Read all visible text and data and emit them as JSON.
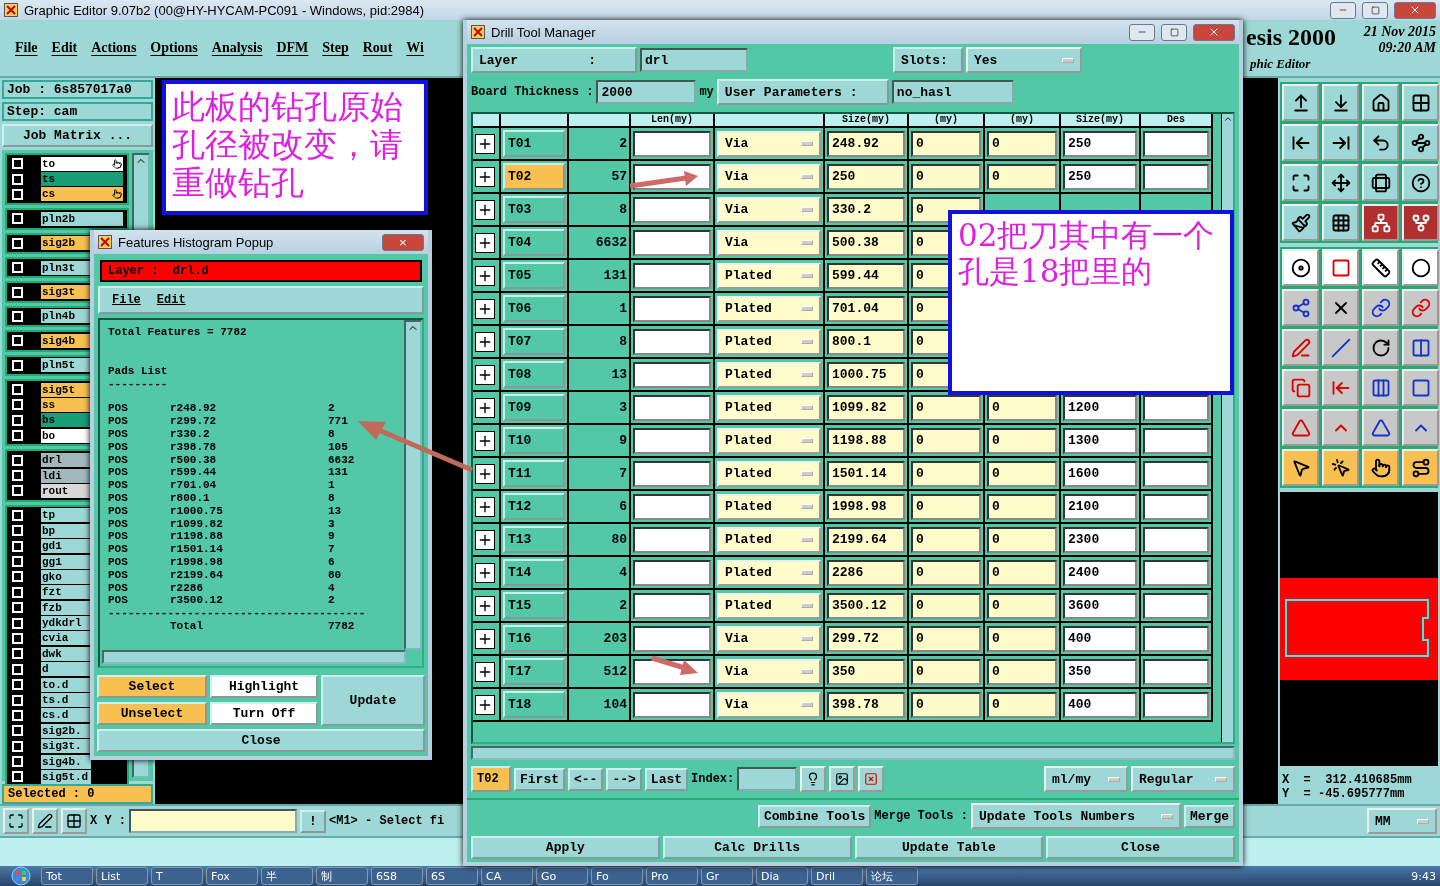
{
  "app": {
    "title": "Graphic Editor 9.07b2 (00@HY-HYCAM-PC091 - Windows, pid:2984)",
    "menu": [
      "File",
      "Edit",
      "Actions",
      "Options",
      "Analysis",
      "DFM",
      "Step",
      "Rout",
      "Wi"
    ],
    "logo_title": "esis 2000",
    "logo_subtitle": "phic Editor",
    "date": "21 Nov 2015",
    "time": "09:20 AM"
  },
  "left_panel": {
    "job": "Job : 6s857017a0",
    "step": "Step: cam",
    "job_matrix": "Job Matrix ...",
    "selected": "Selected : 0",
    "layer_groups": [
      [
        {
          "name": "to",
          "color": "#ffffff",
          "pointer": true,
          "checked": false
        },
        {
          "name": "ts",
          "color": "#1a9e78",
          "pointer": false,
          "checked": false
        },
        {
          "name": "cs",
          "color": "#f8c050",
          "pointer": true,
          "checked": false
        }
      ],
      [
        {
          "name": "pln2b",
          "color": "#9ed8d6",
          "pointer": false,
          "checked": false
        }
      ],
      [
        {
          "name": "sig2b",
          "color": "#f8c050",
          "pointer": false,
          "checked": false
        }
      ],
      [
        {
          "name": "pln3t",
          "color": "#9ed8d6",
          "pointer": false,
          "checked": false
        }
      ],
      [
        {
          "name": "sig3t",
          "color": "#f8c050",
          "pointer": false,
          "checked": false
        }
      ],
      [
        {
          "name": "pln4b",
          "color": "#9ed8d6",
          "pointer": false,
          "checked": false
        }
      ],
      [
        {
          "name": "sig4b",
          "color": "#f8c050",
          "pointer": false,
          "checked": false
        }
      ],
      [
        {
          "name": "pln5t",
          "color": "#9ed8d6",
          "pointer": false,
          "checked": false
        }
      ],
      [
        {
          "name": "sig5t",
          "color": "#f8c050",
          "pointer": false,
          "checked": false
        },
        {
          "name": "ss",
          "color": "#f8c050",
          "pointer": false,
          "checked": false
        },
        {
          "name": "bs",
          "color": "#1a9e78",
          "pointer": false,
          "checked": false
        },
        {
          "name": "bo",
          "color": "#ffffff",
          "pointer": false,
          "checked": false
        }
      ],
      [
        {
          "name": "drl",
          "color": "#a3b8bc",
          "pointer": false,
          "checked": false
        },
        {
          "name": "ldi",
          "color": "#a3b8bc",
          "pointer": false,
          "checked": false
        },
        {
          "name": "rout",
          "color": "#d8d8d8",
          "pointer": false,
          "checked": false
        }
      ],
      [
        {
          "name": "tp",
          "color": "#9ed8d6",
          "pointer": false,
          "checked": false
        },
        {
          "name": "bp",
          "color": "#9ed8d6",
          "pointer": false,
          "checked": false
        },
        {
          "name": "gd1",
          "color": "#9ed8d6",
          "pointer": false,
          "checked": false
        },
        {
          "name": "gg1",
          "color": "#9ed8d6",
          "pointer": false,
          "checked": false
        },
        {
          "name": "gko",
          "color": "#9ed8d6",
          "pointer": false,
          "checked": false
        },
        {
          "name": "fzt",
          "color": "#9ed8d6",
          "pointer": false,
          "checked": false
        },
        {
          "name": "fzb",
          "color": "#9ed8d6",
          "pointer": false,
          "checked": false
        },
        {
          "name": "ydkdrl",
          "color": "#9ed8d6",
          "pointer": false,
          "checked": false
        },
        {
          "name": "cvia",
          "color": "#9ed8d6",
          "pointer": false,
          "checked": false
        },
        {
          "name": "dwk",
          "color": "#9ed8d6",
          "pointer": false,
          "checked": false
        },
        {
          "name": "d",
          "color": "#9ed8d6",
          "pointer": false,
          "checked": false
        },
        {
          "name": "to.d",
          "color": "#9ed8d6",
          "pointer": false,
          "checked": false
        },
        {
          "name": "ts.d",
          "color": "#9ed8d6",
          "pointer": false,
          "checked": false
        },
        {
          "name": "cs.d",
          "color": "#9ed8d6",
          "pointer": false,
          "checked": false
        },
        {
          "name": "sig2b.",
          "color": "#9ed8d6",
          "pointer": false,
          "checked": false
        },
        {
          "name": "sig3t.",
          "color": "#9ed8d6",
          "pointer": false,
          "checked": false
        },
        {
          "name": "sig4b.",
          "color": "#9ed8d6",
          "pointer": false,
          "checked": false
        },
        {
          "name": "sig5t.d",
          "color": "#9ed8d6",
          "pointer": false,
          "checked": false
        }
      ]
    ]
  },
  "annotations": [
    {
      "text": "此板的钻孔原始孔径被改变，请重做钻孔"
    },
    {
      "text": "02把刀其中有一个孔是18把里的"
    }
  ],
  "histogram": {
    "title": "Features Histogram Popup",
    "close": "×",
    "layer": "Layer :  drl.d",
    "menu": [
      "File",
      "Edit"
    ],
    "total_features": "Total Features = 7782",
    "pads_title": "Pads List",
    "pads_rule": "---------",
    "pads": [
      {
        "type": "POS",
        "symbol": "r248.92",
        "count": "2"
      },
      {
        "type": "POS",
        "symbol": "r299.72",
        "count": "771"
      },
      {
        "type": "POS",
        "symbol": "r330.2",
        "count": "8"
      },
      {
        "type": "POS",
        "symbol": "r398.78",
        "count": "105"
      },
      {
        "type": "POS",
        "symbol": "r500.38",
        "count": "6632"
      },
      {
        "type": "POS",
        "symbol": "r599.44",
        "count": "131"
      },
      {
        "type": "POS",
        "symbol": "r701.04",
        "count": "1"
      },
      {
        "type": "POS",
        "symbol": "r800.1",
        "count": "8"
      },
      {
        "type": "POS",
        "symbol": "r1000.75",
        "count": "13"
      },
      {
        "type": "POS",
        "symbol": "r1099.82",
        "count": "3"
      },
      {
        "type": "POS",
        "symbol": "r1198.88",
        "count": "9"
      },
      {
        "type": "POS",
        "symbol": "r1501.14",
        "count": "7"
      },
      {
        "type": "POS",
        "symbol": "r1998.98",
        "count": "6"
      },
      {
        "type": "POS",
        "symbol": "r2199.64",
        "count": "80"
      },
      {
        "type": "POS",
        "symbol": "r2286",
        "count": "4"
      },
      {
        "type": "POS",
        "symbol": "r3500.12",
        "count": "2"
      }
    ],
    "total_rule": "---------------------------------------",
    "total_label": "Total",
    "total": "7782",
    "buttons": [
      "Select",
      "Highlight",
      "Update",
      "Unselect",
      "Turn Off",
      "Close"
    ]
  },
  "drill_manager": {
    "title": "Drill Tool Manager",
    "layer_label": "Layer         :",
    "layer": "drl",
    "slots_label": "Slots:",
    "slots": "Yes",
    "thickness_label": "Board Thickness :",
    "thickness": "2000",
    "thickness_unit": "my",
    "user_params_label": "User Parameters :",
    "user_params": "no_hasl",
    "columns": [
      "Len(my)",
      "Size(my)",
      "(my)",
      "(my)",
      "Size(my)",
      "Des"
    ],
    "tools": [
      {
        "tool": "T01",
        "count": "2",
        "type": "Via",
        "size": "248.92",
        "col_6": "0",
        "col_7": "0",
        "finish": "250",
        "selected": false
      },
      {
        "tool": "T02",
        "count": "57",
        "type": "Via",
        "size": "250",
        "col_6": "0",
        "col_7": "0",
        "finish": "250",
        "selected": true
      },
      {
        "tool": "T03",
        "count": "8",
        "type": "Via",
        "size": "330.2",
        "col_6": "0",
        "selected": false
      },
      {
        "tool": "T04",
        "count": "6632",
        "type": "Via",
        "size": "500.38",
        "col_6": "0",
        "selected": false
      },
      {
        "tool": "T05",
        "count": "131",
        "type": "Plated",
        "size": "599.44",
        "col_6": "0",
        "selected": false
      },
      {
        "tool": "T06",
        "count": "1",
        "type": "Plated",
        "size": "701.04",
        "col_6": "0",
        "selected": false
      },
      {
        "tool": "T07",
        "count": "8",
        "type": "Plated",
        "size": "800.1",
        "col_6": "0",
        "selected": false
      },
      {
        "tool": "T08",
        "count": "13",
        "type": "Plated",
        "size": "1000.75",
        "col_6": "0",
        "selected": false
      },
      {
        "tool": "T09",
        "count": "3",
        "type": "Plated",
        "size": "1099.82",
        "col_6": "0",
        "col_7": "0",
        "finish": "1200",
        "selected": false
      },
      {
        "tool": "T10",
        "count": "9",
        "type": "Plated",
        "size": "1198.88",
        "col_6": "0",
        "col_7": "0",
        "finish": "1300",
        "selected": false
      },
      {
        "tool": "T11",
        "count": "7",
        "type": "Plated",
        "size": "1501.14",
        "col_6": "0",
        "col_7": "0",
        "finish": "1600",
        "selected": false
      },
      {
        "tool": "T12",
        "count": "6",
        "type": "Plated",
        "size": "1998.98",
        "col_6": "0",
        "col_7": "0",
        "finish": "2100",
        "selected": false
      },
      {
        "tool": "T13",
        "count": "80",
        "type": "Plated",
        "size": "2199.64",
        "col_6": "0",
        "col_7": "0",
        "finish": "2300",
        "selected": false
      },
      {
        "tool": "T14",
        "count": "4",
        "type": "Plated",
        "size": "2286",
        "col_6": "0",
        "col_7": "0",
        "finish": "2400",
        "selected": false
      },
      {
        "tool": "T15",
        "count": "2",
        "type": "Plated",
        "size": "3500.12",
        "col_6": "0",
        "col_7": "0",
        "finish": "3600",
        "selected": false
      },
      {
        "tool": "T16",
        "count": "203",
        "type": "Via",
        "size": "299.72",
        "col_6": "0",
        "col_7": "0",
        "finish": "400",
        "selected": false
      },
      {
        "tool": "T17",
        "count": "512",
        "type": "Via",
        "size": "350",
        "col_6": "0",
        "col_7": "0",
        "finish": "350",
        "selected": false
      },
      {
        "tool": "T18",
        "count": "104",
        "type": "Via",
        "size": "398.78",
        "col_6": "0",
        "col_7": "0",
        "finish": "400",
        "selected": false
      }
    ],
    "current_tool": "T02",
    "nav": [
      "First",
      "<--",
      "-->",
      "Last"
    ],
    "index_label": "Index:",
    "units": "ml/my",
    "mode": "Regular",
    "combine": "Combine Tools",
    "merge_label": "Merge Tools :",
    "merge_mode": "Update Tools Numbers",
    "merge": "Merge",
    "actions": [
      "Apply",
      "Calc Drills",
      "Update Table",
      "Close"
    ]
  },
  "coords": {
    "x": "X  =  312.410685mm",
    "y": "Y  = -45.695777mm"
  },
  "bottom_bar": {
    "xy_label": "X Y :",
    "bang": "!",
    "message": "<M1> - Select fi",
    "units": "MM"
  },
  "taskbar": {
    "items": [
      "Tot",
      "List",
      "T",
      "Fox",
      "半",
      "制",
      "6S8",
      "6S",
      "CA",
      "Go",
      "Fo",
      "Pro",
      "Gr",
      "Dia",
      "Dril",
      "论坛"
    ],
    "time": "9:43"
  }
}
